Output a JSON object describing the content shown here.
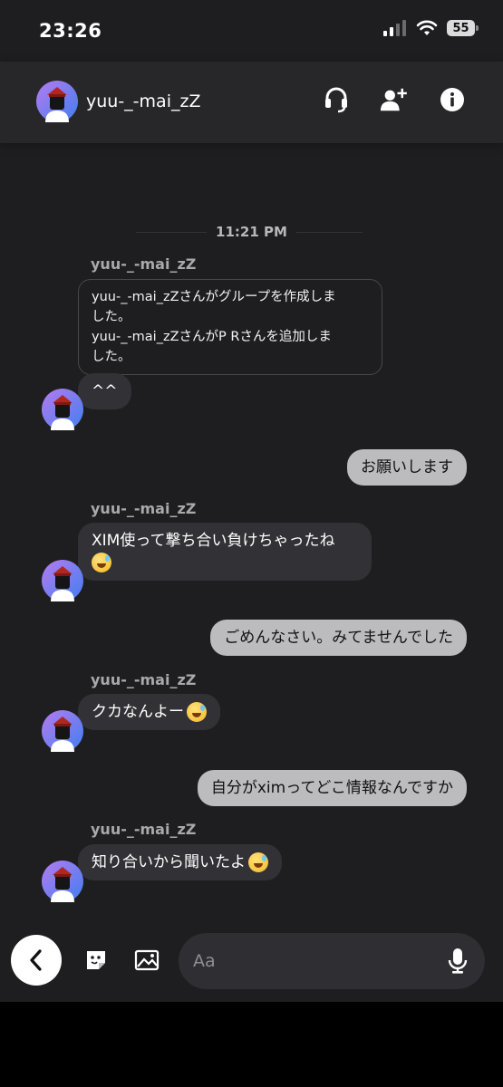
{
  "status_bar": {
    "time": "23:26",
    "battery": "55"
  },
  "header": {
    "name": "yuu-_-mai_zZ",
    "icons": [
      "headset-icon",
      "add-person-icon",
      "info-icon"
    ]
  },
  "timestamp": "11:21 PM",
  "messages": [
    {
      "sender": "yuu-_-mai_zZ",
      "system_lines": [
        "yuu-_-mai_zZさんがグループを作成しま",
        "した。",
        "yuu-_-mai_zZさんがP Rさんを追加しま",
        "した。"
      ]
    },
    {
      "text": "^^"
    },
    {
      "text": "お願いします"
    },
    {
      "sender": "yuu-_-mai_zZ",
      "text": "XIM使って撃ち合い負けちゃったね"
    },
    {
      "text": "ごめんなさい。みてませんでした"
    },
    {
      "sender": "yuu-_-mai_zZ",
      "text": "クカなんよー"
    },
    {
      "text": "自分がximってどこ情報なんですか"
    },
    {
      "sender": "yuu-_-mai_zZ",
      "text": "知り合いから聞いたよ"
    }
  ],
  "composer": {
    "placeholder": "Aa",
    "icons": [
      "back-icon",
      "sticker-icon",
      "image-icon",
      "mic-icon"
    ]
  },
  "colors": {
    "background": "#1e1e20",
    "incoming_bubble": "#323236",
    "outgoing_bubble": "#bcbcbf"
  }
}
